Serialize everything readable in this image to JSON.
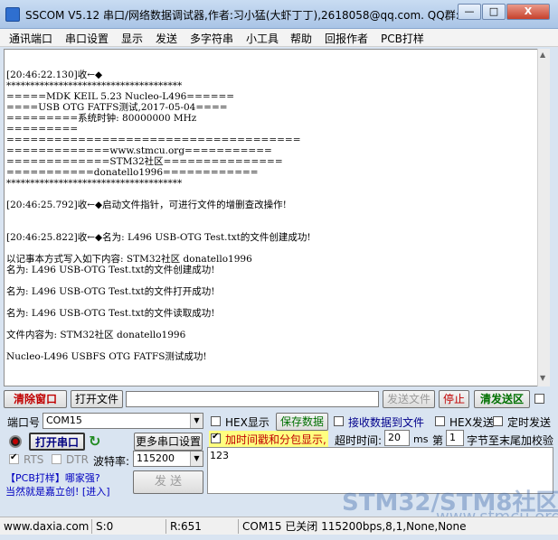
{
  "window": {
    "title": "SSCOM V5.12 串口/网络数据调试器,作者:习小猛(大虾丁丁),2618058@qq.com. QQ群:",
    "minimize": "—",
    "maximize": "□",
    "close": "X"
  },
  "menu": [
    "通讯端口",
    "串口设置",
    "显示",
    "发送",
    "多字符串",
    "小工具",
    "帮助",
    "回报作者",
    "PCB打样"
  ],
  "receive_lines": [
    "",
    "[20:46:22.130]收←◆",
    "*************************************",
    "=====MDK KEIL 5.23 Nucleo-L496======",
    "====USB OTG FATFS测试,2017-05-04====",
    "=========系统时钟: 80000000 MHz",
    "=========",
    "=====================================",
    "=============www.stmcu.org===========",
    "=============STM32社区===============",
    "===========donatello1996============",
    "*************************************",
    "",
    "[20:46:25.792]收←◆启动文件指针，可进行文件的增删查改操作!",
    "",
    "",
    "[20:46:25.822]收←◆名为: L496 USB-OTG Test.txt的文件创建成功!",
    "",
    "以记事本方式写入如下内容: STM32社区 donatello1996",
    "名为: L496 USB-OTG Test.txt的文件创建成功!",
    "",
    "名为: L496 USB-OTG Test.txt的文件打开成功!",
    "",
    "名为: L496 USB-OTG Test.txt的文件读取成功!",
    "",
    "文件内容为: STM32社区 donatello1996",
    "",
    "Nucleo-L496 USBFS OTG FATFS测试成功!"
  ],
  "toolbar": {
    "clear_window": "清除窗口",
    "open_file": "打开文件",
    "file_path": "",
    "send_file": "发送文件",
    "stop": "停止",
    "clear_send": "清发送区"
  },
  "port": {
    "port_label": "端口号",
    "port_value": "COM15",
    "open_port": "打开串口",
    "more_settings": "更多串口设置",
    "rts": "RTS",
    "dtr": "DTR",
    "baud_label": "波特率:",
    "baud_value": "115200",
    "promo_line1": "【PCB打样】哪家强?",
    "promo_line2": "当然就是嘉立创! [进入]",
    "send": "发 送"
  },
  "options": {
    "hex_display": "HEX显示",
    "save_data": "保存数据",
    "recv_to_file": "接收数据到文件",
    "hex_send": "HEX发送",
    "timed_send": "定时发送",
    "timestamp": "加时间戳和分包显示,",
    "timeout_label": "超时时间:",
    "timeout_value": "20",
    "timeout_unit": "ms",
    "nth_label": "第",
    "nth_value": "1",
    "checksum_label": "字节至末尾加校验"
  },
  "send_text": "123",
  "status": {
    "website": "www.daxia.com",
    "sent": "S:0",
    "received": "R:651",
    "port_status": "COM15 已关闭  115200bps,8,1,None,None"
  },
  "watermark": {
    "line1": "STM32/STM8社区",
    "line2": "www.stmcu.org"
  },
  "colors": {
    "red_button": "#c00000",
    "green_button": "#007000",
    "timestamp_bg": "#ffff80"
  }
}
